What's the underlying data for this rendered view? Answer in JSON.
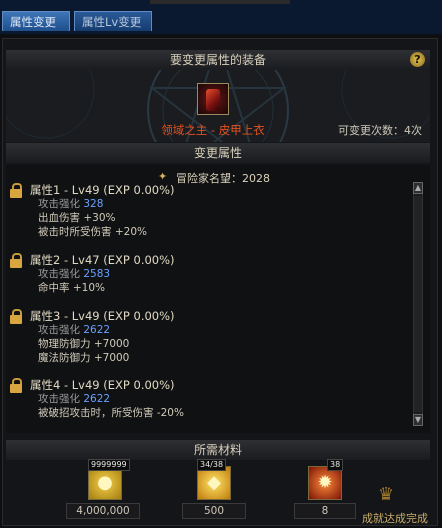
{
  "tabs": [
    {
      "label": "属性变更",
      "active": true
    },
    {
      "label": "属性Lv变更",
      "active": false
    }
  ],
  "equipment_section": {
    "title": "要变更属性的装备",
    "help_icon": "?",
    "item_name": "领域之主 - 皮甲上衣",
    "item_name_color": "#e4511e",
    "remaining_changes": "可变更次数：4次"
  },
  "change_section": {
    "title": "变更属性",
    "fame": "冒险家名望：2028",
    "attributes": [
      {
        "title": "属性1 - Lv49 (EXP 0.00%)",
        "lines": [
          {
            "label": "攻击强化",
            "value": "328"
          },
          {
            "text": "出血伤害 +30%"
          },
          {
            "text": "被击时所受伤害 +20%"
          }
        ]
      },
      {
        "title": "属性2 - Lv47 (EXP 0.00%)",
        "lines": [
          {
            "label": "攻击强化",
            "value": "2583"
          },
          {
            "text": "命中率 +10%"
          }
        ]
      },
      {
        "title": "属性3 - Lv49 (EXP 0.00%)",
        "lines": [
          {
            "label": "攻击强化",
            "value": "2622"
          },
          {
            "text": "物理防御力 +7000"
          },
          {
            "text": "魔法防御力 +7000"
          }
        ]
      },
      {
        "title": "属性4 - Lv49 (EXP 0.00%)",
        "lines": [
          {
            "label": "攻击强化",
            "value": "2622"
          },
          {
            "text": "被破招攻击时，所受伤害 -20%"
          }
        ]
      }
    ]
  },
  "materials_section": {
    "title": "所需材料",
    "items": [
      {
        "icon": "gold-coins-icon",
        "badge": "9999999",
        "quantity": "4,000,000"
      },
      {
        "icon": "gold-crystal-icon",
        "badge": "34/38",
        "quantity": "500"
      },
      {
        "icon": "fire-orb-icon",
        "badge": "38",
        "quantity": "8"
      }
    ]
  },
  "achievement": "成就达成完成"
}
